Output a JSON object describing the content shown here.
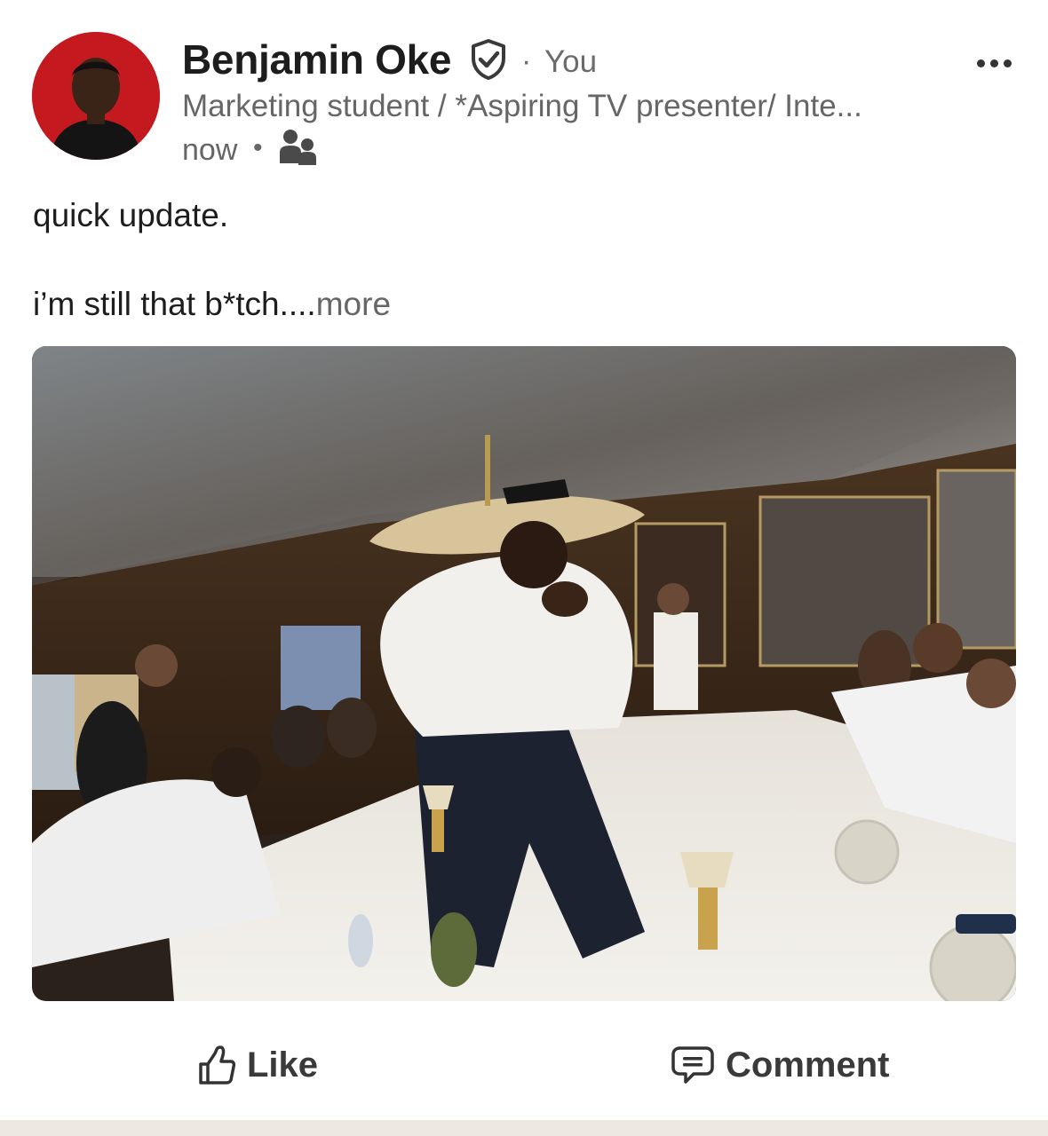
{
  "post": {
    "author": {
      "name": "Benjamin Oke",
      "relationship": "You",
      "separator": "·",
      "headline": "Marketing student / *Aspiring TV presenter/ Inte...",
      "avatar_icon": "profile-photo",
      "verified_icon": "verified-shield-icon"
    },
    "meta": {
      "time": "now",
      "separator": "•",
      "audience_icon": "connections-icon"
    },
    "menu_icon": "more-options-icon",
    "text": {
      "line1": "quick update.",
      "line2": "i’m still that b*tch....",
      "see_more": "more"
    },
    "photo": {
      "icon": "post-photo"
    },
    "actions": {
      "like_label": "Like",
      "like_icon": "thumbs-up-icon",
      "comment_label": "Comment",
      "comment_icon": "comment-icon"
    }
  },
  "colors": {
    "text_primary": "#1d1d1d",
    "text_secondary": "#666666",
    "avatar_bg": "#c4191f",
    "footer_band": "#ede9e2"
  }
}
